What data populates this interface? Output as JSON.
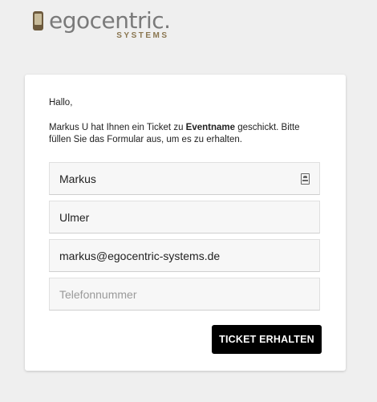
{
  "logo": {
    "name": "egocentric.",
    "subtitle": "SYSTEMS",
    "icon": "phone-icon"
  },
  "card": {
    "greeting": "Hallo,",
    "message_pre": "Markus U hat Ihnen ein Ticket zu ",
    "event_name": "Eventname",
    "message_post": " geschickt. Bitte füllen Sie das Formular aus, um es zu erhalten."
  },
  "form": {
    "first_name": {
      "value": "Markus",
      "icon": "contact-card-icon"
    },
    "last_name": {
      "value": "Ulmer"
    },
    "email": {
      "value": "markus@egocentric-systems.de"
    },
    "phone": {
      "value": "",
      "placeholder": "Telefonnummer"
    },
    "submit_label": "TICKET ERHALTEN"
  },
  "colors": {
    "background": "#efefef",
    "brand_gold": "#8a7650",
    "button": "#000000"
  }
}
